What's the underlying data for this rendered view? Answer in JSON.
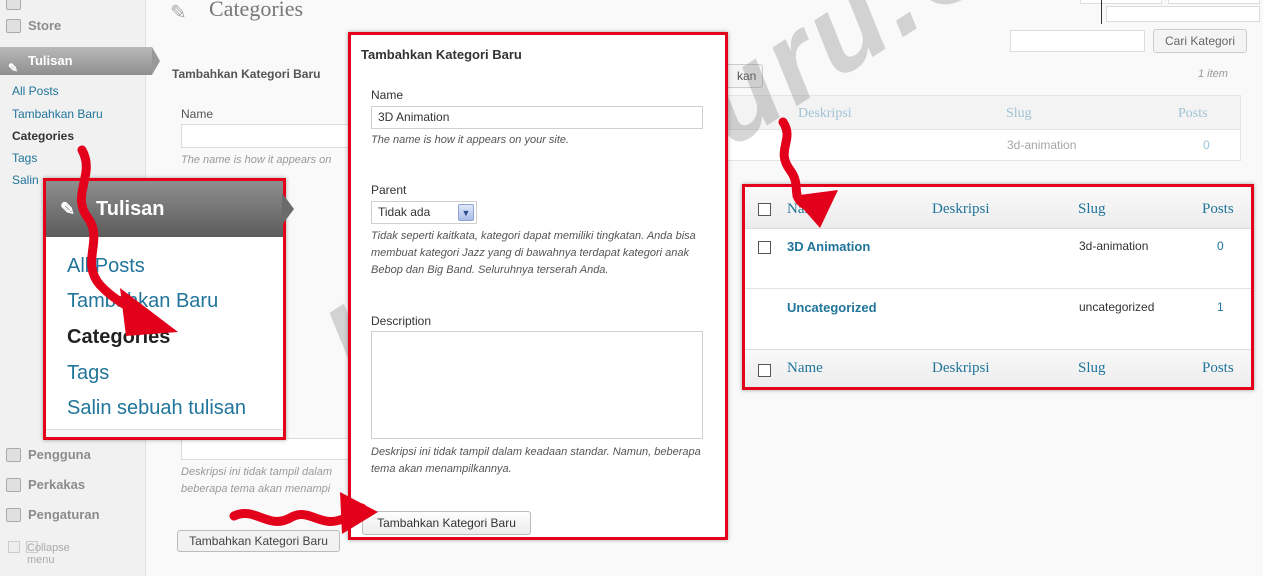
{
  "sidebar": {
    "items": [
      {
        "label": "Store"
      },
      {
        "label": "Tulisan"
      },
      {
        "label": "Pengguna"
      },
      {
        "label": "Perkakas"
      },
      {
        "label": "Pengaturan"
      }
    ],
    "submenu": [
      "All Posts",
      "Tambahkan Baru",
      "Categories",
      "Tags",
      "Salin"
    ],
    "collapse_label": "Collapse menu"
  },
  "page": {
    "title": "Categories",
    "section_title": "Tambahkan Kategori Baru",
    "name_label": "Name",
    "name_hint": "The name is how it appears on",
    "desc_hint": "Deskripsi ini tidak tampil dalam beberapa tema akan menampi",
    "submit_label": "Tambahkan Kategori Baru",
    "bulk_button_label": "kan",
    "search_button_label": "Cari Kategori",
    "item_count": "1 item"
  },
  "bg_table": {
    "headers": [
      "Deskripsi",
      "Slug",
      "Posts"
    ],
    "row": {
      "slug": "3d-animation",
      "posts": "0"
    }
  },
  "menu_callout": {
    "header": "Tulisan",
    "links": [
      "All Posts",
      "Tambahkan Baru",
      "Categories",
      "Tags",
      "Salin sebuah tulisan"
    ]
  },
  "form": {
    "title": "Tambahkan Kategori Baru",
    "name_label": "Name",
    "name_value": "3D Animation",
    "name_hint": "The name is how it appears on your site.",
    "parent_label": "Parent",
    "parent_value": "Tidak ada",
    "parent_hint": "Tidak seperti kaitkata, kategori dapat memiliki tingkatan. Anda bisa membuat kategori Jazz yang di bawahnya terdapat kategori anak Bebop dan Big Band. Seluruhnya terserah Anda.",
    "description_label": "Description",
    "description_value": "",
    "description_hint": "Deskripsi ini tidak tampil dalam keadaan standar. Namun, beberapa tema akan menampilkannya.",
    "submit_label": "Tambahkan Kategori Baru"
  },
  "table": {
    "columns": [
      "Name",
      "Deskripsi",
      "Slug",
      "Posts"
    ],
    "rows": [
      {
        "name": "3D Animation",
        "description": "",
        "slug": "3d-animation",
        "posts": "0"
      },
      {
        "name": "Uncategorized",
        "description": "",
        "slug": "uncategorized",
        "posts": "1"
      }
    ]
  },
  "watermark": "KaryaGuru.Com",
  "colors": {
    "callout_border": "#e3001b",
    "link": "#21759b"
  }
}
